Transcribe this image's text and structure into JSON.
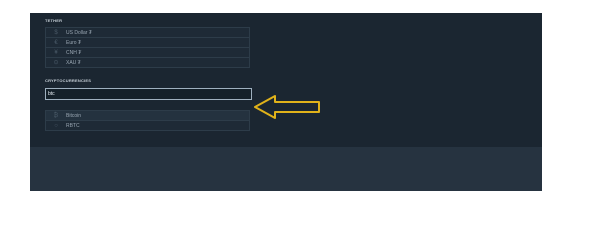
{
  "tether": {
    "title": "TETHER",
    "items": [
      {
        "icon": "$",
        "label": "US Dollar ₮"
      },
      {
        "icon": "€",
        "label": "Euro ₮"
      },
      {
        "icon": "¥",
        "label": "CNH ₮"
      },
      {
        "icon": "⊙",
        "label": "XAU ₮"
      }
    ]
  },
  "cryptocurrencies": {
    "title": "CRYPTOCURRENCIES",
    "search_value": "btc",
    "items": [
      {
        "icon": "₿",
        "label": "Bitcoin"
      },
      {
        "icon": "○",
        "label": "RBTC"
      }
    ]
  },
  "annotation": {
    "arrow_color": "#e0b21a"
  }
}
